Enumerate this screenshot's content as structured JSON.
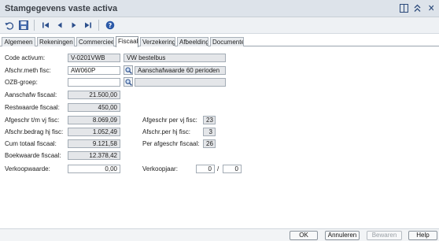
{
  "window": {
    "title": "Stamgegevens vaste activa"
  },
  "toolbar": {
    "icons": [
      "undo-icon",
      "save-icon",
      "first-record-icon",
      "previous-record-icon",
      "next-record-icon",
      "last-record-icon",
      "help-icon"
    ]
  },
  "tabs": [
    {
      "label": "Algemeen"
    },
    {
      "label": "Rekeningen"
    },
    {
      "label": "Commercieel"
    },
    {
      "label": "Fiscaal"
    },
    {
      "label": "Verzekering"
    },
    {
      "label": "Afbeelding"
    },
    {
      "label": "Documenten"
    }
  ],
  "fiscaal": {
    "code_activum": {
      "label": "Code activum:",
      "value": "V-0201VWB",
      "description": "VW bestelbus"
    },
    "afschr_meth": {
      "label": "Afschr.meth fisc:",
      "value": "AW060P",
      "description": "Aanschafwaarde 60 perioden"
    },
    "ozb_groep": {
      "label": "OZB-groep:",
      "value": "",
      "description": ""
    },
    "aanschafw": {
      "label": "Aanschafw fiscaal:",
      "value": "21.500,00"
    },
    "restwaarde": {
      "label": "Restwaarde fiscaal:",
      "value": "450,00"
    },
    "afgeschr_vj": {
      "label": "Afgeschr t/m vj fisc:",
      "value": "8.069,09"
    },
    "afschr_bedrag": {
      "label": "Afschr.bedrag hj fisc:",
      "value": "1.052,49"
    },
    "cum_totaal": {
      "label": "Cum totaal fiscaal:",
      "value": "9.121,58"
    },
    "boekwaarde": {
      "label": "Boekwaarde fiscaal:",
      "value": "12.378,42"
    },
    "verkoopwaarde": {
      "label": "Verkoopwaarde:",
      "value": "0,00"
    },
    "afgeschr_per_vj": {
      "label": "Afgeschr per vj fisc:",
      "value": "23"
    },
    "afschr_per_hj": {
      "label": "Afschr.per hj fisc:",
      "value": "3"
    },
    "per_afgeschr": {
      "label": "Per afgeschr fiscaal:",
      "value": "26"
    },
    "verkoopjaar": {
      "label": "Verkoopjaar:",
      "value": "0",
      "separator": "/",
      "period": "0"
    }
  },
  "buttons": {
    "ok": "OK",
    "annuleren": "Annuleren",
    "bewaren": "Bewaren",
    "help": "Help"
  }
}
